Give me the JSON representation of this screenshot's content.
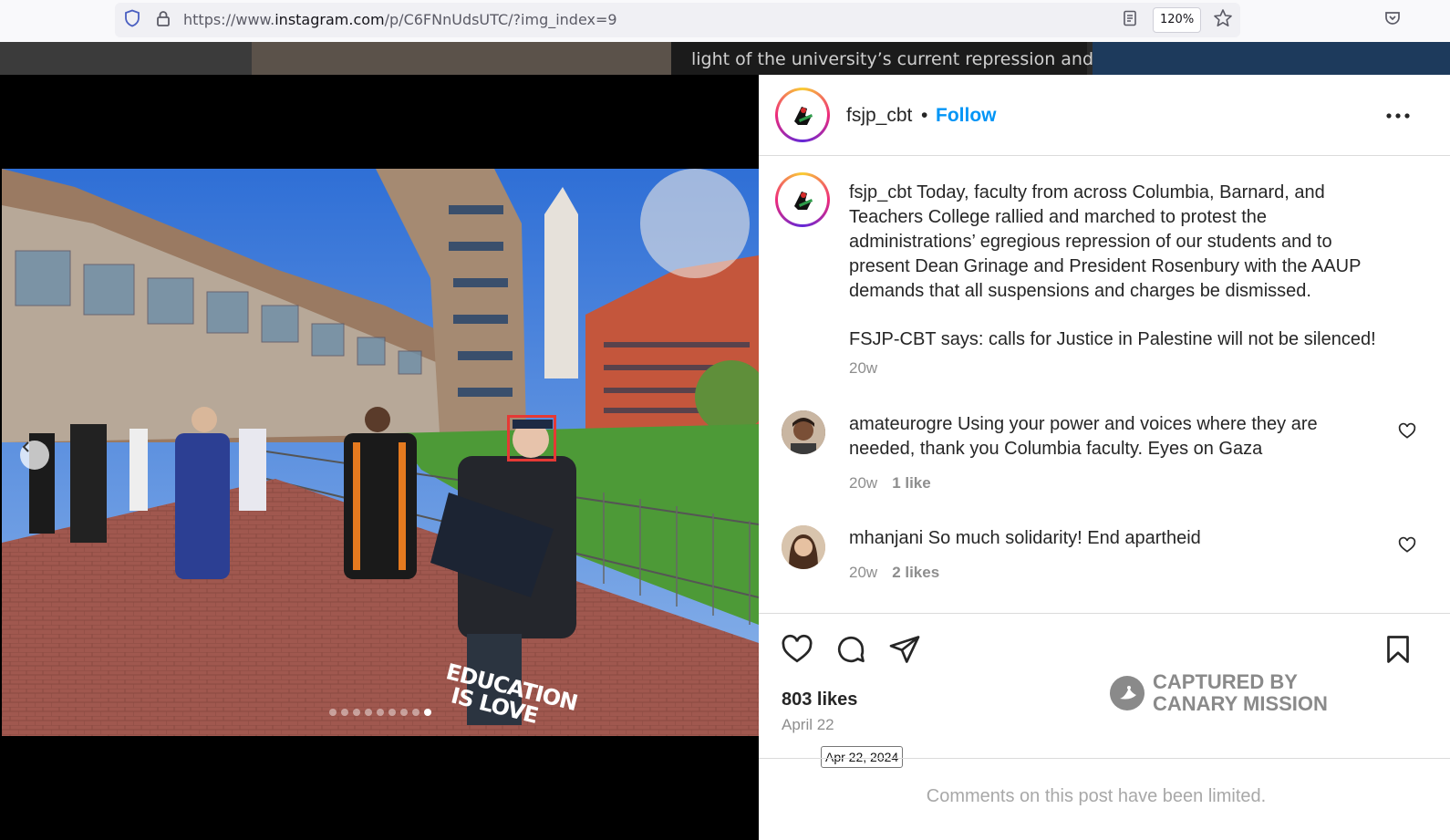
{
  "browser": {
    "url_prefix": "https://www.",
    "url_domain": "instagram.com",
    "url_path": "/p/C6FNnUdsUTC/?img_index=9",
    "zoom": "120%",
    "icons": [
      "shield-icon",
      "lock-icon",
      "reader-view-icon",
      "bookmark-star-icon",
      "pocket-icon"
    ]
  },
  "background": {
    "text": "light of the university’s current repression and"
  },
  "photo": {
    "sign_line1": "EDUCATION",
    "sign_line2": "IS LOVE",
    "carousel_total": 9,
    "carousel_index": 9
  },
  "post": {
    "username": "fsjp_cbt",
    "follow_label": "Follow",
    "separator": "•",
    "caption_p1": "Today, faculty from across Columbia, Barnard, and Teachers College rallied and marched to protest the administrations’ egregious repression of our students and to present Dean Grinage and President Rosenbury with the AAUP demands that all suspensions and charges be dismissed.",
    "caption_p2": "FSJP-CBT says: calls for Justice in Palestine will not be silenced!",
    "caption_time": "20w",
    "comments": [
      {
        "username": "amateurogre",
        "text": "Using your power and voices where they are needed, thank you Columbia faculty. Eyes on Gaza",
        "time": "20w",
        "likes": "1 like"
      },
      {
        "username": "mhanjani",
        "text": "So much solidarity! End apartheid",
        "time": "20w",
        "likes": "2 likes"
      }
    ],
    "likes": "803 likes",
    "date": "April 22",
    "date_tooltip": "Apr 22, 2024",
    "comments_limited": "Comments on this post have been limited."
  },
  "watermark": {
    "line1": "CAPTURED BY",
    "line2": "CANARY MISSION"
  },
  "colors": {
    "follow_blue": "#0095f6",
    "highlight_red": "#e53935",
    "text_primary": "#262626",
    "text_secondary": "#8e8e8e"
  }
}
